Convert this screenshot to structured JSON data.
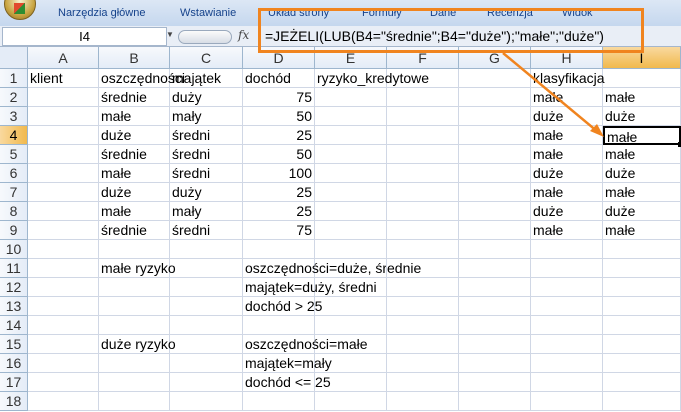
{
  "ribbon": {
    "tabs": [
      "Narzędzia główne",
      "Wstawianie",
      "Układ strony",
      "Formuły",
      "Dane",
      "Recenzja",
      "Widok"
    ]
  },
  "formula_bar": {
    "name_box": "I4",
    "fx_label": "fx",
    "formula": "=JEŻELI(LUB(B4=\"średnie\";B4=\"duże\");\"małe\";\"duże\")"
  },
  "accent_color": "#f0841f",
  "columns": [
    "A",
    "B",
    "C",
    "D",
    "E",
    "F",
    "G",
    "H",
    "I"
  ],
  "selected_column": "I",
  "selected_row": 4,
  "active_cell": "I4",
  "rows": [
    {
      "n": "1",
      "cells": {
        "A": "klient",
        "B": "oszczędności",
        "C": "majątek",
        "D": "dochód",
        "E": "ryzyko_kredytowe",
        "H": "klasyfikacja"
      }
    },
    {
      "n": "2",
      "cells": {
        "B": "średnie",
        "C": "duży",
        "D": "75",
        "H": "małe",
        "I": "małe"
      }
    },
    {
      "n": "3",
      "cells": {
        "B": "małe",
        "C": "mały",
        "D": "50",
        "H": "duże",
        "I": "duże"
      }
    },
    {
      "n": "4",
      "cells": {
        "B": "duże",
        "C": "średni",
        "D": "25",
        "H": "małe",
        "I": "małe"
      }
    },
    {
      "n": "5",
      "cells": {
        "B": "średnie",
        "C": "średni",
        "D": "50",
        "H": "małe",
        "I": "małe"
      }
    },
    {
      "n": "6",
      "cells": {
        "B": "małe",
        "C": "średni",
        "D": "100",
        "H": "duże",
        "I": "duże"
      }
    },
    {
      "n": "7",
      "cells": {
        "B": "duże",
        "C": "duży",
        "D": "25",
        "H": "małe",
        "I": "małe"
      }
    },
    {
      "n": "8",
      "cells": {
        "B": "małe",
        "C": "mały",
        "D": "25",
        "H": "duże",
        "I": "duże"
      }
    },
    {
      "n": "9",
      "cells": {
        "B": "średnie",
        "C": "średni",
        "D": "75",
        "H": "małe",
        "I": "małe"
      }
    },
    {
      "n": "10",
      "cells": {}
    },
    {
      "n": "11",
      "cells": {
        "B": "małe ryzyko",
        "D": "oszczędności=duże, średnie"
      }
    },
    {
      "n": "12",
      "cells": {
        "D": "majątek=duży, średni"
      }
    },
    {
      "n": "13",
      "cells": {
        "D": "dochód > 25"
      }
    },
    {
      "n": "14",
      "cells": {}
    },
    {
      "n": "15",
      "cells": {
        "B": "duże ryzyko",
        "D": "oszczędności=małe"
      }
    },
    {
      "n": "16",
      "cells": {
        "D": "majątek=mały"
      }
    },
    {
      "n": "17",
      "cells": {
        "D": "dochód <= 25"
      }
    },
    {
      "n": "18",
      "cells": {}
    }
  ]
}
